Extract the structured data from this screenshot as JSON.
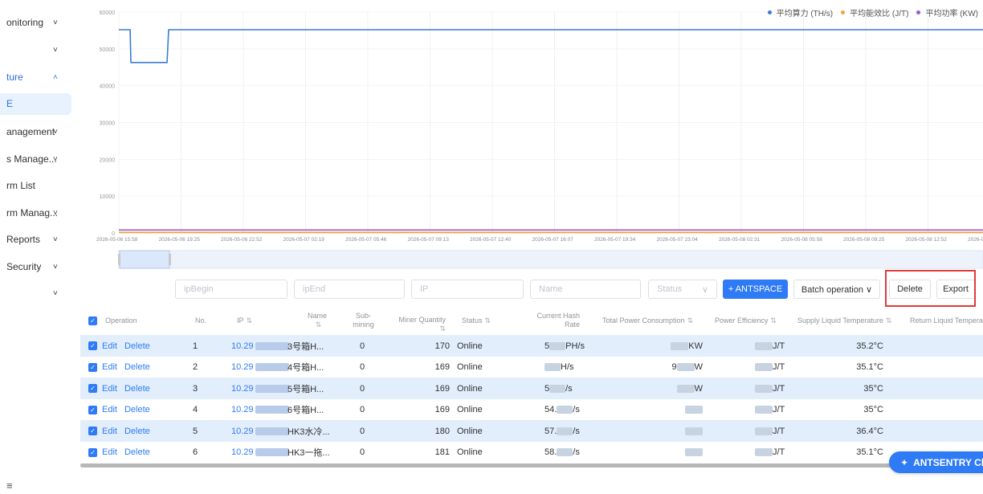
{
  "sidebar": {
    "items": [
      {
        "label": "onitoring",
        "chev": "˅",
        "blue": false
      },
      {
        "label": "",
        "chev": "˅",
        "blue": false
      },
      {
        "label": "ture",
        "chev": "˄",
        "blue": true
      },
      {
        "label": "anagement",
        "chev": "˅",
        "blue": false
      },
      {
        "label": "s Manage...",
        "chev": "˅",
        "blue": false
      },
      {
        "label": "rm List",
        "chev": "",
        "blue": false
      },
      {
        "label": "rm Manag...",
        "chev": "˅",
        "blue": false
      },
      {
        "label": " Reports",
        "chev": "˅",
        "blue": false
      },
      {
        "label": "Security",
        "chev": "˅",
        "blue": false
      },
      {
        "label": "",
        "chev": "˅",
        "blue": false
      }
    ],
    "selected_label": "E",
    "menu_icon": "≡"
  },
  "chart_data": {
    "type": "line",
    "x": [
      "2026-05-06 15:58",
      "2026-05-06 19:25",
      "2026-05-06 22:52",
      "2026-05-07 02:19",
      "2026-05-07 05:46",
      "2026-05-07 09:13",
      "2026-05-07 12:40",
      "2026-05-07 16:07",
      "2026-05-07 19:34",
      "2026-05-07 23:04",
      "2026-05-08 02:31",
      "2026-05-08 05:58",
      "2026-05-08 09:25",
      "2026-05-08 12:52",
      "2026-05"
    ],
    "y_ticks": [
      "60000",
      "50000",
      "40000",
      "30000",
      "20000",
      "10000",
      "0"
    ],
    "ylim": [
      0,
      60000
    ],
    "series": [
      {
        "name": "平均算力 (TH/s)",
        "color": "#3a7bd5",
        "values": [
          55200,
          46300,
          55200,
          55200,
          55200,
          55200,
          55200,
          55200,
          55200,
          55200,
          55200,
          55200,
          55200,
          55200,
          55200
        ]
      },
      {
        "name": "平均能效比 (J/T)",
        "color": "#f2a33a",
        "values": [
          150,
          150,
          150,
          150,
          150,
          150,
          150,
          150,
          150,
          150,
          150,
          150,
          150,
          150,
          150
        ]
      },
      {
        "name": "平均功率 (KW)",
        "color": "#9b59d0",
        "values": [
          800,
          800,
          800,
          800,
          800,
          800,
          800,
          800,
          800,
          800,
          800,
          800,
          800,
          800,
          800
        ]
      }
    ],
    "grid": true,
    "legend": "top-right"
  },
  "filters": {
    "ip_begin_placeholder": "ipBegin",
    "ip_end_placeholder": "ipEnd",
    "ip_placeholder": "IP",
    "name_placeholder": "Name",
    "status_placeholder": "Status",
    "status_chevron": "∨"
  },
  "toolbar": {
    "antspace": "+ ANTSPACE",
    "batch": "Batch operation ∨",
    "delete": "Delete",
    "export": "Export"
  },
  "table": {
    "headers": {
      "operation": "Operation",
      "no": "No.",
      "ip": "IP",
      "name": "Name",
      "submining": "Sub-\nmining",
      "miner_qty": "Miner Quantity",
      "status": "Status",
      "hash_rate": "Current Hash\nRate",
      "power": "Total Power Consumption",
      "efficiency": "Power Efficiency",
      "supply_temp": "Supply Liquid Temperature",
      "return_temp": "Return Liquid Tempera"
    },
    "sort_icon": "⇅",
    "edit": "Edit",
    "delete": "Delete",
    "rows": [
      {
        "no": "1",
        "ip": "10.29",
        "name": "3号箱H...",
        "sub": "0",
        "qty": "170",
        "status": "Online",
        "hash": "5",
        "hash_unit": "PH/s",
        "power": "",
        "power_unit": "KW",
        "eff": "",
        "eff_unit": "J/T",
        "supply": "35.2°C"
      },
      {
        "no": "2",
        "ip": "10.29",
        "name": "4号箱H...",
        "sub": "0",
        "qty": "169",
        "status": "Online",
        "hash": "",
        "hash_unit": "H/s",
        "power": "9",
        "power_unit": "W",
        "eff": "",
        "eff_unit": "J/T",
        "supply": "35.1°C"
      },
      {
        "no": "3",
        "ip": "10.29",
        "name": "5号箱H...",
        "sub": "0",
        "qty": "169",
        "status": "Online",
        "hash": "5",
        "hash_unit": "/s",
        "power": "",
        "power_unit": "W",
        "eff": "",
        "eff_unit": "J/T",
        "supply": "35°C"
      },
      {
        "no": "4",
        "ip": "10.29",
        "name": "6号箱H...",
        "sub": "0",
        "qty": "169",
        "status": "Online",
        "hash": "54.",
        "hash_unit": "/s",
        "power": "",
        "power_unit": "",
        "eff": "",
        "eff_unit": "J/T",
        "supply": "35°C"
      },
      {
        "no": "5",
        "ip": "10.29",
        "name": "HK3水冷...",
        "sub": "0",
        "qty": "180",
        "status": "Online",
        "hash": "57.",
        "hash_unit": "/s",
        "power": "",
        "power_unit": "",
        "eff": "",
        "eff_unit": "J/T",
        "supply": "36.4°C"
      },
      {
        "no": "6",
        "ip": "10.29",
        "name": "HK3一拖...",
        "sub": "0",
        "qty": "181",
        "status": "Online",
        "hash": "58.",
        "hash_unit": "/s",
        "power": "",
        "power_unit": "",
        "eff": "",
        "eff_unit": "J/T",
        "supply": "35.1°C"
      }
    ]
  },
  "chat": {
    "label": "ANTSENTRY Cha",
    "icon": "✦"
  }
}
